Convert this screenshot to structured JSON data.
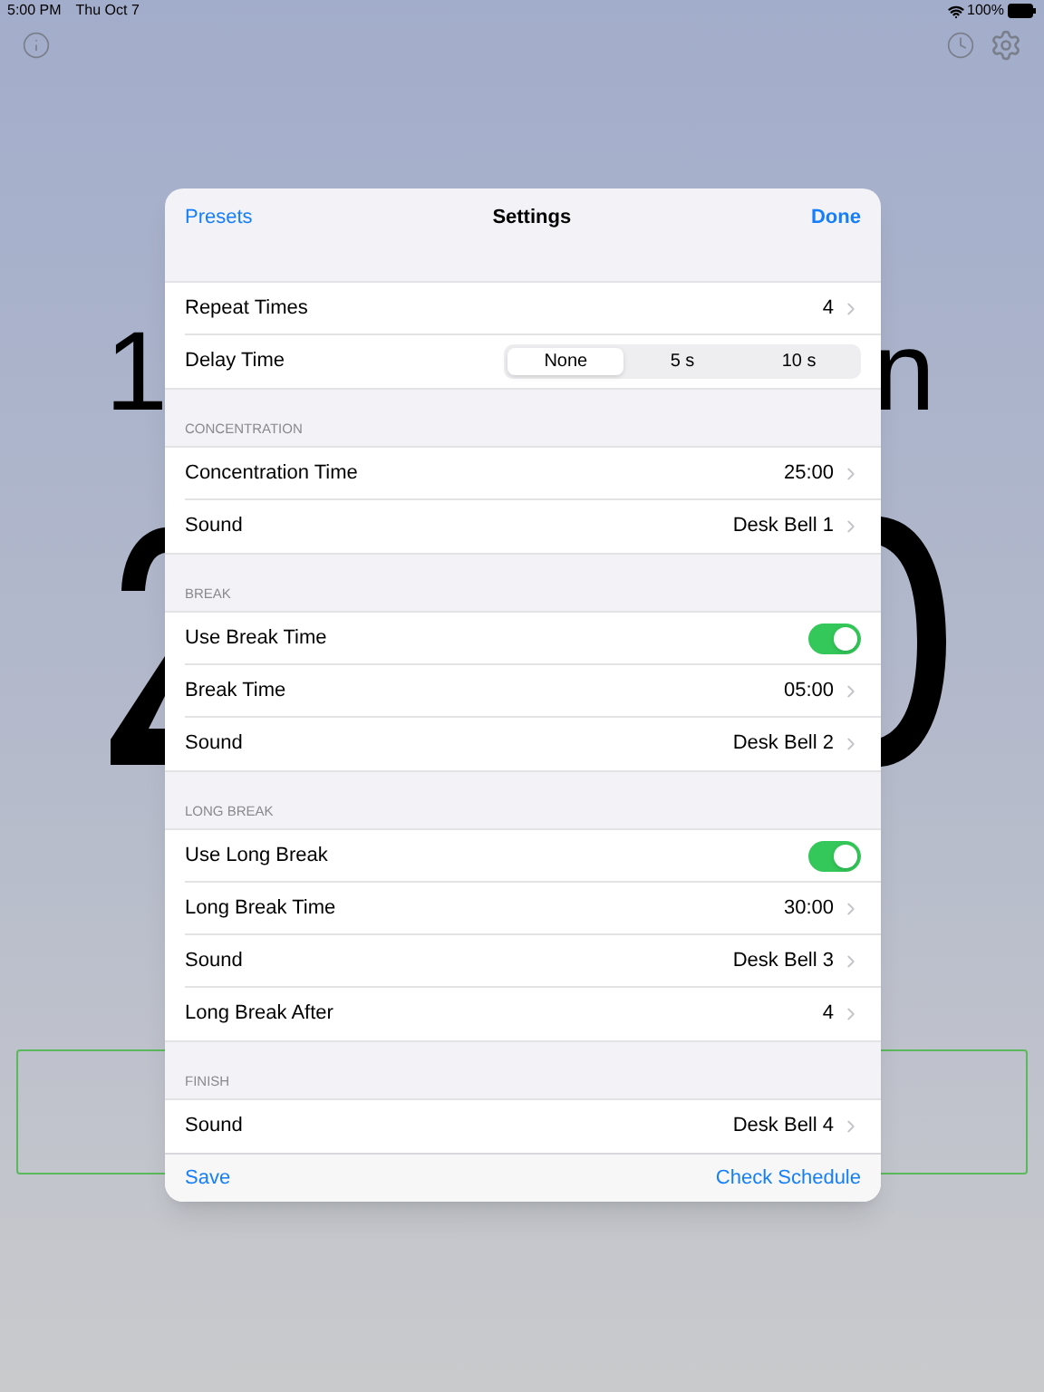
{
  "status_bar": {
    "time": "5:00 PM",
    "date": "Thu Oct 7",
    "battery": "100%"
  },
  "background": {
    "title_fragments": [
      "1",
      "n"
    ]
  },
  "modal": {
    "left_button": "Presets",
    "title": "Settings",
    "right_button": "Done",
    "sections": [
      {
        "rows": [
          {
            "kind": "value",
            "label": "Repeat Times",
            "value": "4"
          },
          {
            "kind": "segmented",
            "label": "Delay Time",
            "options": [
              {
                "label": "None",
                "selected": true
              },
              {
                "label": "5 s",
                "selected": false
              },
              {
                "label": "10 s",
                "selected": false
              }
            ]
          }
        ]
      },
      {
        "header": "CONCENTRATION",
        "rows": [
          {
            "kind": "value",
            "label": "Concentration Time",
            "value": "25:00"
          },
          {
            "kind": "value",
            "label": "Sound",
            "value": "Desk Bell 1"
          }
        ]
      },
      {
        "header": "BREAK",
        "rows": [
          {
            "kind": "toggle",
            "label": "Use Break Time",
            "on": true
          },
          {
            "kind": "value",
            "label": "Break Time",
            "value": "05:00"
          },
          {
            "kind": "value",
            "label": "Sound",
            "value": "Desk Bell 2"
          }
        ]
      },
      {
        "header": "LONG BREAK",
        "rows": [
          {
            "kind": "toggle",
            "label": "Use Long Break",
            "on": true
          },
          {
            "kind": "value",
            "label": "Long Break Time",
            "value": "30:00"
          },
          {
            "kind": "value",
            "label": "Sound",
            "value": "Desk Bell 3"
          },
          {
            "kind": "value",
            "label": "Long Break After",
            "value": "4"
          }
        ]
      },
      {
        "header": "FINISH",
        "rows": [
          {
            "kind": "value",
            "label": "Sound",
            "value": "Desk Bell 4"
          }
        ]
      }
    ],
    "footer_left": "Save",
    "footer_right": "Check Schedule"
  }
}
